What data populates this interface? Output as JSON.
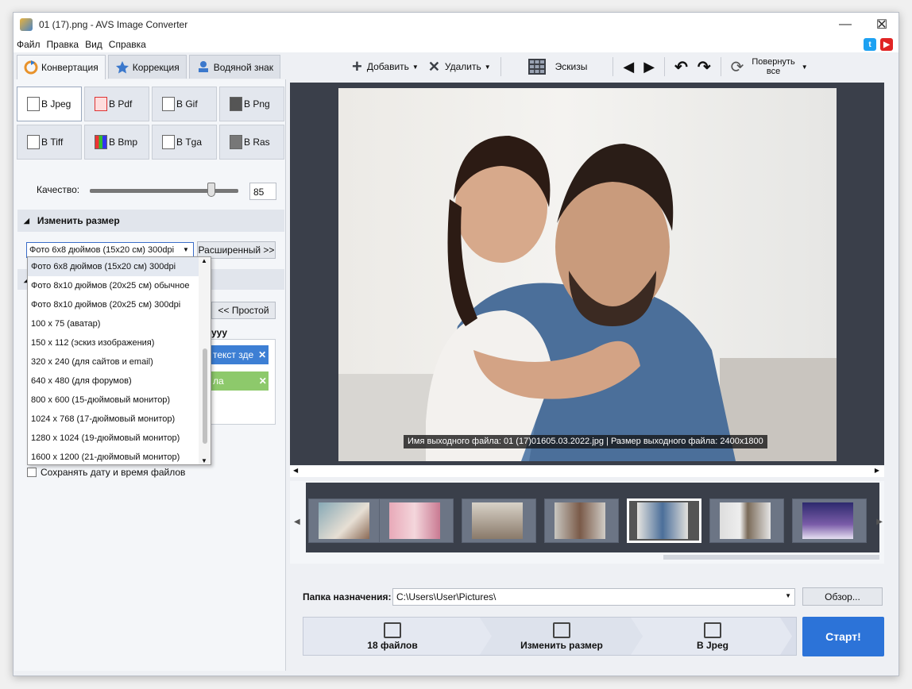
{
  "window": {
    "title": "01 (17).png - AVS Image Converter",
    "minimize": "—",
    "maximize": "☐",
    "close": "✕"
  },
  "menu": [
    "Файл",
    "Правка",
    "Вид",
    "Справка"
  ],
  "social": {
    "twitter": "t",
    "youtube": "▶"
  },
  "tabs": [
    "Конвертация",
    "Коррекция",
    "Водяной знак"
  ],
  "toolbar": {
    "add": "Добавить",
    "remove": "Удалить",
    "thumbs": "Эскизы",
    "rotate_all_line1": "Повернуть",
    "rotate_all_line2": "все"
  },
  "formats": [
    "В Jpeg",
    "В Pdf",
    "В Gif",
    "В Png",
    "В Tiff",
    "В Bmp",
    "В Tga",
    "В Ras"
  ],
  "quality": {
    "label": "Качество:",
    "value": "85",
    "level": 0.85
  },
  "resize": {
    "section_title": "Изменить размер",
    "selected": "Фото 6x8 дюймов (15x20 см) 300dpi",
    "advanced_button": "Расширенный >>",
    "options": [
      "Фото 6x8 дюймов (15x20 см) 300dpi",
      "Фото 8x10 дюймов (20x25 см) обычное",
      "Фото 8x10 дюймов (20x25 см) 300dpi",
      "100 x 75 (аватар)",
      "150 x 112 (эскиз изображения)",
      "320 x 240 (для сайтов и email)",
      "640 x 480 (для форумов)",
      "800 x 600 (15-дюймовый монитор)",
      "1024 x 768 (17-дюймовый монитор)",
      "1280 x 1024 (19-дюймовый монитор)",
      "1600 x 1200 (21-дюймовый монитор)"
    ]
  },
  "behind": {
    "simple_button": "<< Простой",
    "group_fragment": "ууу",
    "text_chip": "текст зде",
    "image_chip": "ла",
    "keep_date": "Сохранять дату и время файлов"
  },
  "preview": {
    "caption": "Имя выходного файла: 01 (17)01605.03.2022.jpg | Размер выходного файла: 2400x1800"
  },
  "footer": {
    "dest_label": "Папка назначения:",
    "dest_path": "C:\\Users\\User\\Pictures\\",
    "browse": "Обзор...",
    "step1": "18 файлов",
    "step2": "Изменить размер",
    "step3": "В Jpeg",
    "start": "Старт!"
  },
  "colors": {
    "accent": "#2c73d8",
    "preview_bg": "#3a3f4a",
    "chip_blue": "#3d7fd4",
    "chip_green": "#8dc96b"
  }
}
